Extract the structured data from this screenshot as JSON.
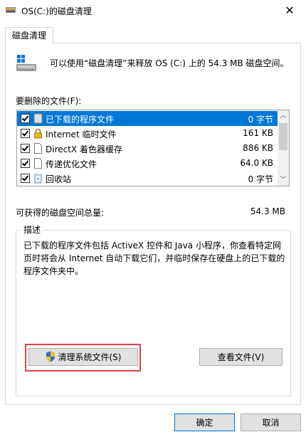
{
  "window": {
    "title": "OS(C:)的磁盘清理",
    "close_glyph": "✕"
  },
  "tabs": [
    {
      "label": "磁盘清理"
    }
  ],
  "header": {
    "message": "可以使用“磁盘清理”来释放 OS (C:) 上的 54.3 MB 磁盘空间。"
  },
  "files": {
    "label": "要删除的文件(F):",
    "items": [
      {
        "name": "已下载的程序文件",
        "size": "0 字节",
        "checked": true,
        "selected": true,
        "icon": "folder-icon"
      },
      {
        "name": "Internet 临时文件",
        "size": "161 KB",
        "checked": true,
        "selected": false,
        "icon": "lock-icon"
      },
      {
        "name": "DirectX 着色器缓存",
        "size": "886 KB",
        "checked": true,
        "selected": false,
        "icon": "document-icon"
      },
      {
        "name": "传递优化文件",
        "size": "64.0 KB",
        "checked": true,
        "selected": false,
        "icon": "document-icon"
      },
      {
        "name": "回收站",
        "size": "0 字节",
        "checked": true,
        "selected": false,
        "icon": "recycle-bin-icon"
      }
    ]
  },
  "summary": {
    "label": "可获得的磁盘空间总量:",
    "value": "54.3 MB"
  },
  "description": {
    "title": "描述",
    "text": "已下载的程序文件包括 ActiveX 控件和 Java 小程序，你查看特定网页时将会从 Internet 自动下载它们，并临时保存在硬盘上的已下载的程序文件夹中。"
  },
  "buttons": {
    "clean_system": "清理系统文件(S)",
    "view_files": "查看文件(V)",
    "ok": "确定",
    "cancel": "取消"
  },
  "colors": {
    "selection": "#0078d7",
    "highlight_border": "#d9454a"
  }
}
